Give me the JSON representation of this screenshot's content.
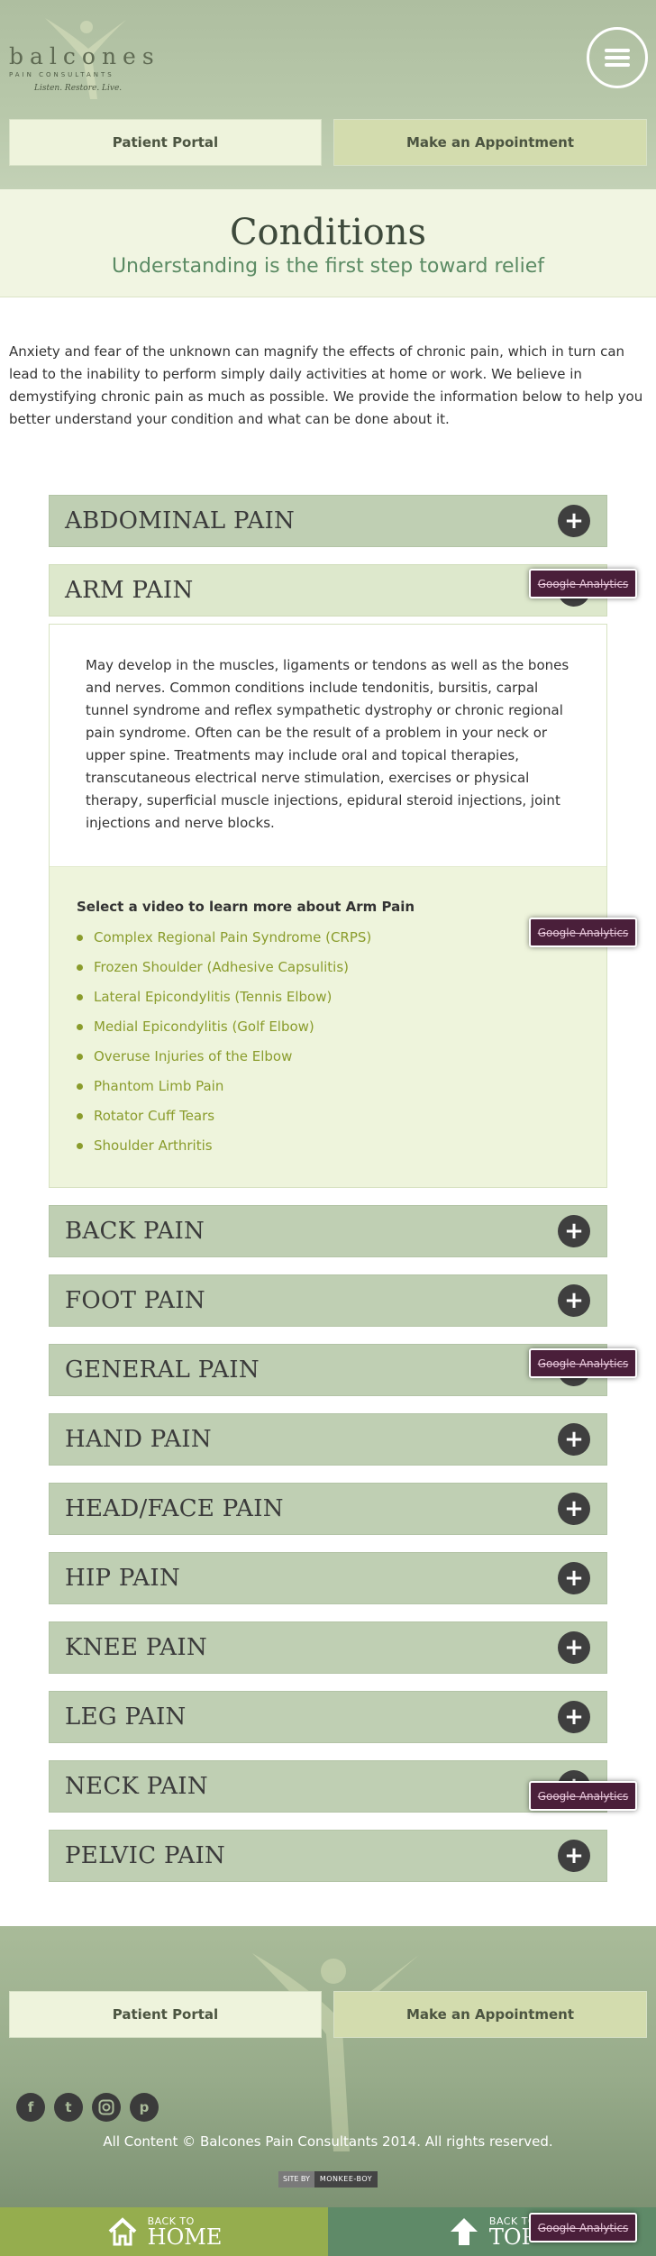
{
  "header": {
    "logo_wordmark": "balcones",
    "logo_sub": "PAIN CONSULTANTS",
    "logo_tagline": "Listen. Restore. Live.",
    "menu_icon": "hamburger-icon",
    "patient_portal": "Patient Portal",
    "appointment": "Make an Appointment"
  },
  "page": {
    "title": "Conditions",
    "subtitle": "Understanding is the first step toward relief",
    "intro": "Anxiety and fear of the unknown can magnify the effects of chronic pain, which in turn can lead to the inability to perform simply daily activities at home or work. We believe in demystifying chronic pain as much as possible. We provide the information below to help you better understand your condition and what can be done about it."
  },
  "accordion": {
    "items": [
      "ABDOMINAL PAIN",
      "ARM PAIN",
      "BACK PAIN",
      "FOOT PAIN",
      "GENERAL PAIN",
      "HAND PAIN",
      "HEAD/FACE PAIN",
      "HIP PAIN",
      "KNEE PAIN",
      "LEG PAIN",
      "NECK PAIN",
      "PELVIC PAIN"
    ],
    "expand_icon": "plus-circle-icon",
    "open": {
      "description": "May develop in the muscles, ligaments or tendons as well as the bones and nerves. Common conditions include tendonitis, bursitis, carpal tunnel syndrome and reflex sympathetic dystrophy or chronic regional pain syndrome. Often can be the result of a problem in your neck or upper spine. Treatments may include oral and topical therapies, transcutaneous electrical nerve stimulation, exercises or physical therapy, superficial muscle injections, epidural steroid injections, joint injections and nerve blocks.",
      "video_heading": "Select a video to learn more about Arm Pain",
      "videos": [
        "Complex Regional Pain Syndrome (CRPS)",
        "Frozen Shoulder (Adhesive Capsulitis)",
        "Lateral Epicondylitis (Tennis Elbow)",
        "Medial Epicondylitis (Golf Elbow)",
        "Overuse Injuries of the Elbow",
        "Phantom Limb Pain",
        "Rotator Cuff Tears",
        "Shoulder Arthritis"
      ]
    }
  },
  "ga_badge": "Google Analytics",
  "footer": {
    "patient_portal": "Patient Portal",
    "appointment": "Make an Appointment",
    "social": [
      "facebook-icon",
      "twitter-icon",
      "instagram-icon",
      "pinterest-icon"
    ],
    "copyright": "All Content © Balcones Pain Consultants 2014. All rights reserved.",
    "siteby_a": "SITE BY",
    "siteby_b": "MONKEE-BOY",
    "back_home_small": "BACK TO",
    "back_home_big": "HOME",
    "back_top_small": "BACK TO",
    "back_top_big": "TOP"
  },
  "colors": {
    "accordion_bg": "#bfcfb3",
    "accordion_open_bg": "#dde8cc",
    "video_link": "#8a9c2c",
    "subtitle": "#5b8b64",
    "back_home": "#95ad4e",
    "back_top": "#5f8a68"
  }
}
